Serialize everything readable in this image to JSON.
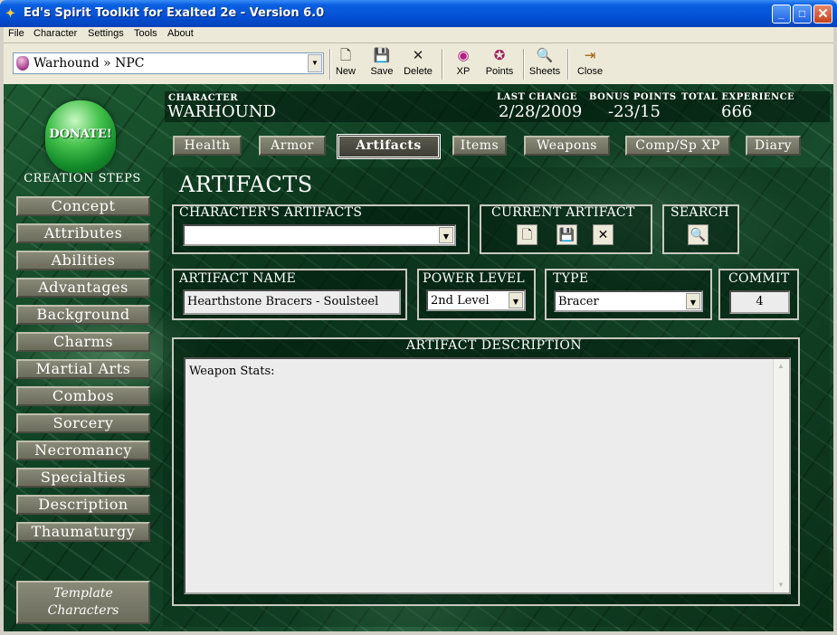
{
  "window": {
    "title": "Ed's Spirit Toolkit for Exalted 2e - Version 6.0",
    "buttons": {
      "minimize": "_",
      "maximize": "□",
      "close": "✕"
    }
  },
  "menu": [
    "File",
    "Character",
    "Settings",
    "Tools",
    "About"
  ],
  "toolbar": {
    "character_select": "Warhound » NPC",
    "buttons": [
      {
        "label": "New",
        "icon": "new-file-icon",
        "glyph": "🗋"
      },
      {
        "label": "Save",
        "icon": "floppy-disk-icon",
        "glyph": "💾"
      },
      {
        "label": "Delete",
        "icon": "delete-x-icon",
        "glyph": "✕"
      },
      {
        "label": "XP",
        "icon": "xp-icon",
        "glyph": "◉"
      },
      {
        "label": "Points",
        "icon": "points-icon",
        "glyph": "✪"
      },
      {
        "label": "Sheets",
        "icon": "sheets-icon",
        "glyph": "🔍"
      },
      {
        "label": "Close",
        "icon": "exit-door-icon",
        "glyph": "⇥"
      }
    ]
  },
  "sidebar": {
    "donate": "DONATE!",
    "steps_title": "CREATION STEPS",
    "steps": [
      "Concept",
      "Attributes",
      "Abilities",
      "Advantages",
      "Background",
      "Charms",
      "Martial Arts",
      "Combos",
      "Sorcery",
      "Necromancy",
      "Specialties",
      "Description",
      "Thaumaturgy"
    ],
    "template_line1": "Template",
    "template_line2": "Characters"
  },
  "header": {
    "character_label": "CHARACTER",
    "character_name": "WARHOUND",
    "last_change_label": "LAST CHANGE",
    "last_change": "2/28/2009",
    "bonus_points_label": "BONUS POINTS",
    "bonus_points": "-23/15",
    "total_xp_label": "TOTAL EXPERIENCE",
    "total_xp": "666"
  },
  "tabs": [
    {
      "label": "Health",
      "active": false
    },
    {
      "label": "Armor",
      "active": false
    },
    {
      "label": "Artifacts",
      "active": true
    },
    {
      "label": "Items",
      "active": false
    },
    {
      "label": "Weapons",
      "active": false
    },
    {
      "label": "Comp/Sp XP",
      "active": false
    },
    {
      "label": "Diary",
      "active": false
    }
  ],
  "artifacts": {
    "title": "ARTIFACTS",
    "characters_artifacts_label": "CHARACTER'S ARTIFACTS",
    "characters_artifacts_value": "",
    "current_artifact_label": "CURRENT ARTIFACT",
    "search_label": "SEARCH",
    "name_label": "ARTIFACT NAME",
    "name_value": "Hearthstone Bracers - Soulsteel",
    "power_level_label": "POWER LEVEL",
    "power_level_value": "2nd Level",
    "type_label": "TYPE",
    "type_value": "Bracer",
    "commit_label": "COMMIT",
    "commit_value": "4",
    "description_label": "ARTIFACT DESCRIPTION",
    "description_value": "Weapon Stats:"
  },
  "colors": {
    "title_bar": "#0451d6",
    "marble_dark": "#0d3a20",
    "button_face": "#7a7a6a"
  }
}
